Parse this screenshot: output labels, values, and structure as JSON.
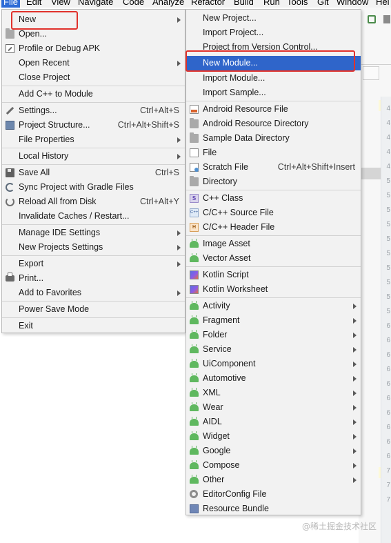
{
  "menubar": {
    "items": [
      "File",
      "Edit",
      "View",
      "Navigate",
      "Code",
      "Analyze",
      "Refactor",
      "Build",
      "Run",
      "Tools",
      "Git",
      "Window",
      "Hel"
    ]
  },
  "file_menu": {
    "items": [
      {
        "label": "New",
        "icon": "none"
      },
      {
        "label": "Open...",
        "icon": "folder-icon"
      },
      {
        "label": "Profile or Debug APK",
        "icon": "profile-icon"
      },
      {
        "label": "Open Recent",
        "icon": "none"
      },
      {
        "label": "Close Project",
        "icon": "none"
      },
      {
        "label": "Add C++ to Module",
        "icon": "none"
      },
      {
        "label": "Settings...",
        "shortcut": "Ctrl+Alt+S",
        "icon": "wrench-icon"
      },
      {
        "label": "Project Structure...",
        "shortcut": "Ctrl+Alt+Shift+S",
        "icon": "project-structure-icon"
      },
      {
        "label": "File Properties",
        "icon": "none"
      },
      {
        "label": "Local History",
        "icon": "none"
      },
      {
        "label": "Save All",
        "shortcut": "Ctrl+S",
        "icon": "save-icon"
      },
      {
        "label": "Sync Project with Gradle Files",
        "icon": "sync-icon"
      },
      {
        "label": "Reload All from Disk",
        "shortcut": "Ctrl+Alt+Y",
        "icon": "reload-icon"
      },
      {
        "label": "Invalidate Caches / Restart...",
        "icon": "none"
      },
      {
        "label": "Manage IDE Settings",
        "icon": "none"
      },
      {
        "label": "New Projects Settings",
        "icon": "none"
      },
      {
        "label": "Export",
        "icon": "none"
      },
      {
        "label": "Print...",
        "icon": "print-icon"
      },
      {
        "label": "Add to Favorites",
        "icon": "none"
      },
      {
        "label": "Power Save Mode",
        "icon": "none"
      },
      {
        "label": "Exit",
        "icon": "none"
      }
    ]
  },
  "new_submenu": {
    "items": [
      {
        "label": "New Project..."
      },
      {
        "label": "Import Project..."
      },
      {
        "label": "Project from Version Control..."
      },
      {
        "label": "New Module..."
      },
      {
        "label": "Import Module..."
      },
      {
        "label": "Import Sample..."
      },
      {
        "label": "Android Resource File",
        "icon": "android-resource-file-icon"
      },
      {
        "label": "Android Resource Directory",
        "icon": "folder-icon"
      },
      {
        "label": "Sample Data Directory",
        "icon": "folder-icon"
      },
      {
        "label": "File",
        "icon": "file-icon"
      },
      {
        "label": "Scratch File",
        "shortcut": "Ctrl+Alt+Shift+Insert",
        "icon": "scratch-file-icon"
      },
      {
        "label": "Directory",
        "icon": "folder-icon"
      },
      {
        "label": "C++ Class",
        "icon": "cpp-class-icon"
      },
      {
        "label": "C/C++ Source File",
        "icon": "cpp-source-icon"
      },
      {
        "label": "C/C++ Header File",
        "icon": "cpp-header-icon"
      },
      {
        "label": "Image Asset",
        "icon": "android-icon"
      },
      {
        "label": "Vector Asset",
        "icon": "android-icon"
      },
      {
        "label": "Kotlin Script",
        "icon": "kotlin-icon"
      },
      {
        "label": "Kotlin Worksheet",
        "icon": "kotlin-icon"
      },
      {
        "label": "Activity",
        "icon": "android-icon"
      },
      {
        "label": "Fragment",
        "icon": "android-icon"
      },
      {
        "label": "Folder",
        "icon": "android-icon"
      },
      {
        "label": "Service",
        "icon": "android-icon"
      },
      {
        "label": "UiComponent",
        "icon": "android-icon"
      },
      {
        "label": "Automotive",
        "icon": "android-icon"
      },
      {
        "label": "XML",
        "icon": "android-icon"
      },
      {
        "label": "Wear",
        "icon": "android-icon"
      },
      {
        "label": "AIDL",
        "icon": "android-icon"
      },
      {
        "label": "Widget",
        "icon": "android-icon"
      },
      {
        "label": "Google",
        "icon": "android-icon"
      },
      {
        "label": "Compose",
        "icon": "android-icon"
      },
      {
        "label": "Other",
        "icon": "android-icon"
      },
      {
        "label": "EditorConfig File",
        "icon": "gear-icon"
      },
      {
        "label": "Resource Bundle",
        "icon": "resource-bundle-icon"
      }
    ]
  },
  "gutter_numbers": [
    "4",
    "4",
    "4",
    "4",
    "4",
    "5",
    "5",
    "5",
    "5",
    "5",
    "5",
    "5",
    "5",
    "5",
    "5",
    "6",
    "6",
    "6",
    "6",
    "6",
    "6",
    "6",
    "6",
    "6",
    "6",
    "7",
    "7",
    "7"
  ],
  "watermark": "@稀土掘金技术社区",
  "colors": {
    "highlight": "#2f65ca",
    "annotation_box": "#e0312b",
    "android_green": "#5fb85f"
  }
}
